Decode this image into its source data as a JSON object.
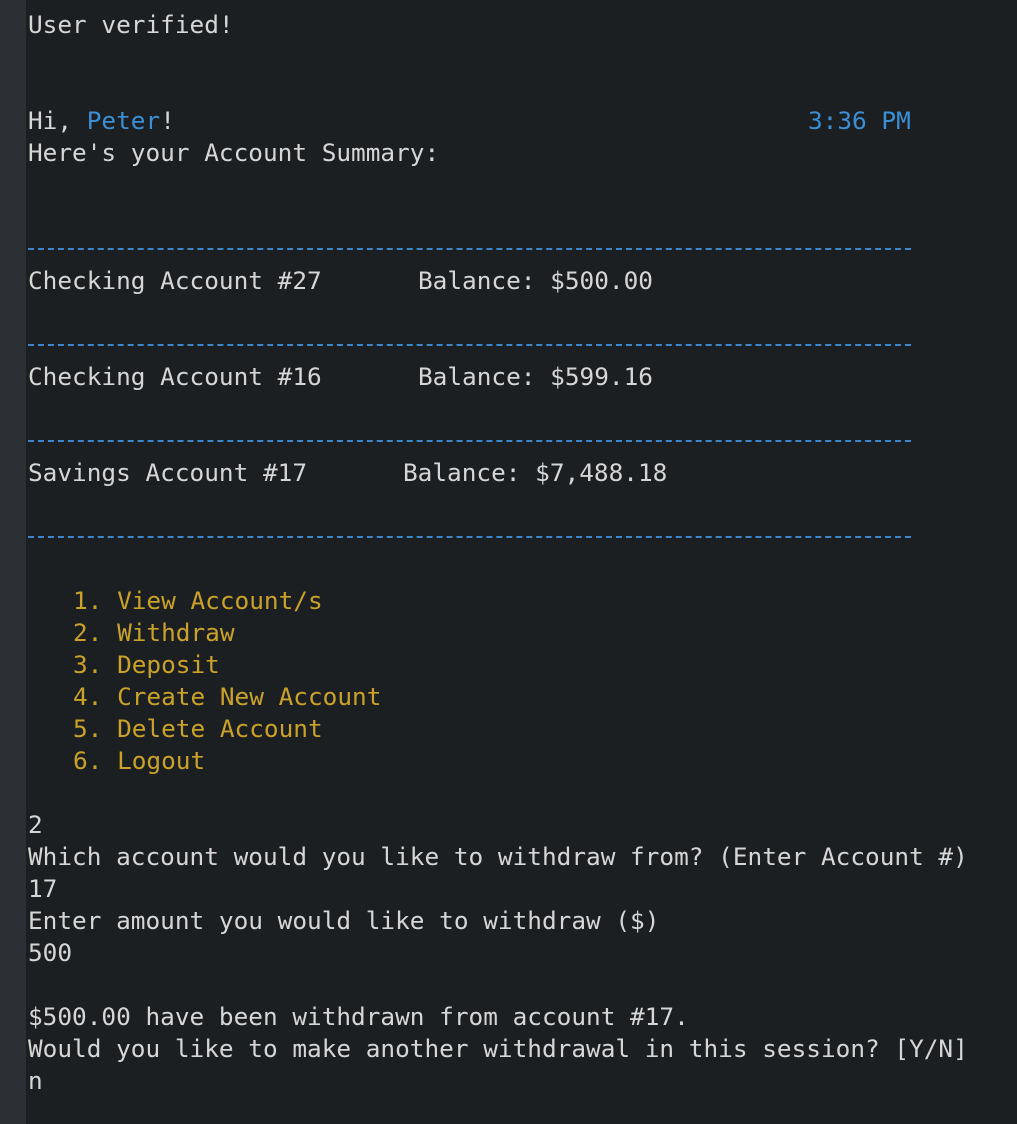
{
  "status": "User verified!",
  "greeting": {
    "prefix": "Hi, ",
    "name": "Peter",
    "suffix": "!",
    "time": "3:36 PM",
    "subtitle": "Here's your Account Summary:"
  },
  "accounts": [
    {
      "name": "Checking Account #27",
      "balance_label": "Balance:",
      "balance": "$500.00"
    },
    {
      "name": "Checking Account #16",
      "balance_label": "Balance:",
      "balance": "$599.16"
    },
    {
      "name": "Savings Account #17",
      "balance_label": "Balance:",
      "balance": "$7,488.18"
    }
  ],
  "menu": [
    {
      "num": "1.",
      "label": "View Account/s"
    },
    {
      "num": "2.",
      "label": "Withdraw"
    },
    {
      "num": "3.",
      "label": "Deposit"
    },
    {
      "num": "4.",
      "label": "Create New Account"
    },
    {
      "num": "5.",
      "label": "Delete Account"
    },
    {
      "num": "6.",
      "label": "Logout"
    }
  ],
  "session": {
    "menu_choice": "2",
    "prompt_account": "Which account would you like to withdraw from? (Enter Account #)",
    "account_input": "17",
    "prompt_amount": "Enter amount you would like to withdraw ($)",
    "amount_input": "500",
    "result": "$500.00 have been withdrawn from account #17.",
    "prompt_again": "Would you like to make another withdrawal in this session? [Y/N]",
    "again_input": "n"
  },
  "colors": {
    "background": "#1c1f22",
    "text": "#d6d6d6",
    "accent_blue": "#3b8fd4",
    "menu_gold": "#c9a227"
  }
}
